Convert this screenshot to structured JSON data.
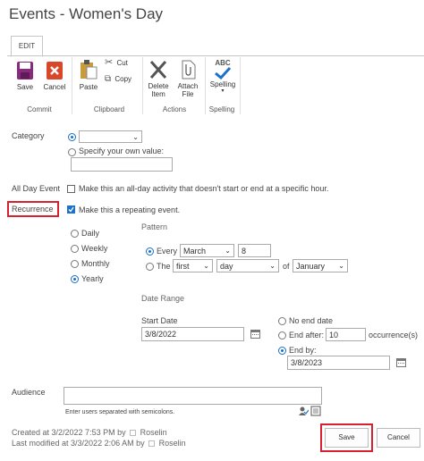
{
  "page_title": "Events - Women's Day",
  "ribbon": {
    "tab": "EDIT",
    "buttons": {
      "save": "Save",
      "cancel": "Cancel",
      "paste": "Paste",
      "cut": "Cut",
      "copy": "Copy",
      "delete_item_1": "Delete",
      "delete_item_2": "Item",
      "attach_file_1": "Attach",
      "attach_file_2": "File",
      "spelling": "Spelling",
      "spelling_logo": "ABC"
    },
    "groups": {
      "commit": "Commit",
      "clipboard": "Clipboard",
      "actions": "Actions",
      "spelling": "Spelling"
    }
  },
  "form": {
    "category": {
      "label": "Category",
      "select_value": "",
      "specify_label": "Specify your own value:",
      "specify_value": ""
    },
    "all_day": {
      "label": "All Day Event",
      "text": "Make this an all-day activity that doesn't start or end at a specific hour.",
      "checked": false
    },
    "recurrence": {
      "label": "Recurrence",
      "text": "Make this a repeating event.",
      "checked": true,
      "frequencies": [
        "Daily",
        "Weekly",
        "Monthly",
        "Yearly"
      ],
      "selected_frequency": "Yearly",
      "pattern_label": "Pattern",
      "every_label": "Every",
      "every_month": "March",
      "every_day": "8",
      "the_label": "The",
      "the_ordinal": "first",
      "the_daytype": "day",
      "of_label": "of",
      "the_month": "January",
      "date_range_label": "Date Range",
      "start_date_label": "Start Date",
      "start_date": "3/8/2022",
      "no_end_label": "No end date",
      "end_after_label": "End after:",
      "end_after_value": "10",
      "occurrences_label": "occurrence(s)",
      "end_by_label": "End by:",
      "end_by_value": "3/8/2023"
    },
    "audience": {
      "label": "Audience",
      "value": "",
      "hint": "Enter users separated with semicolons."
    }
  },
  "footer": {
    "created_text": "Created at 3/2/2022 7:53 PM by",
    "created_by": "Roselin",
    "modified_text": "Last modified at 3/3/2022 2:06 AM by",
    "modified_by": "Roselin",
    "save": "Save",
    "cancel": "Cancel"
  },
  "colors": {
    "accent": "#1a73c8",
    "highlight_red": "#d8212f",
    "save_icon": "#8a2a7d",
    "cancel_icon": "#d9472b"
  }
}
